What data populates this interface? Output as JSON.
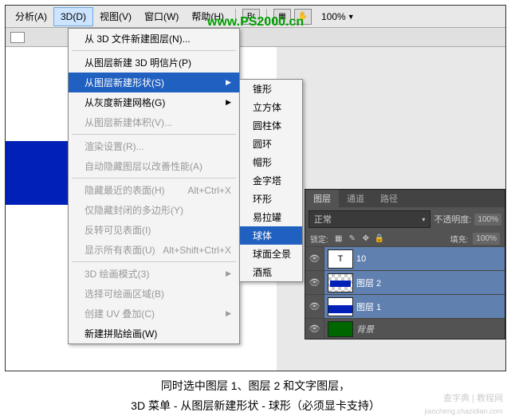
{
  "watermark": "www.PS2000.cn",
  "menubar": {
    "items": [
      "分析(A)",
      "3D(D)",
      "视图(V)",
      "窗口(W)",
      "帮助(H)"
    ],
    "zoom": "100%"
  },
  "dropdown": {
    "items": [
      {
        "label": "从 3D 文件新建图层(N)...",
        "disabled": false
      },
      {
        "sep": true
      },
      {
        "label": "从图层新建 3D 明信片(P)",
        "disabled": false
      },
      {
        "label": "从图层新建形状(S)",
        "hl": true,
        "arrow": true
      },
      {
        "label": "从灰度新建网格(G)",
        "arrow": true
      },
      {
        "label": "从图层新建体积(V)...",
        "disabled": true
      },
      {
        "sep": true
      },
      {
        "label": "渲染设置(R)...",
        "disabled": true
      },
      {
        "label": "自动隐藏图层以改善性能(A)",
        "disabled": true
      },
      {
        "sep": true
      },
      {
        "label": "隐藏最近的表面(H)",
        "shortcut": "Alt+Ctrl+X",
        "disabled": true
      },
      {
        "label": "仅隐藏封闭的多边形(Y)",
        "disabled": true
      },
      {
        "label": "反转可见表面(I)",
        "disabled": true
      },
      {
        "label": "显示所有表面(U)",
        "shortcut": "Alt+Shift+Ctrl+X",
        "disabled": true
      },
      {
        "sep": true
      },
      {
        "label": "3D 绘画模式(3)",
        "disabled": true,
        "arrow": true
      },
      {
        "label": "选择可绘画区域(B)",
        "disabled": true
      },
      {
        "label": "创建 UV 叠加(C)",
        "disabled": true,
        "arrow": true
      },
      {
        "label": "新建拼贴绘画(W)",
        "disabled": false
      }
    ]
  },
  "submenu": {
    "items": [
      "锥形",
      "立方体",
      "圆柱体",
      "圆环",
      "帽形",
      "金字塔",
      "环形",
      "易拉罐",
      "球体",
      "球面全景",
      "酒瓶"
    ],
    "hl_index": 8
  },
  "layerspanel": {
    "tabs": [
      "图层",
      "通道",
      "路径"
    ],
    "blendmode": "正常",
    "opacity_label": "不透明度:",
    "opacity": "100%",
    "lock_label": "锁定:",
    "fill_label": "填充:",
    "fill": "100%",
    "layers": [
      {
        "thumb": "T",
        "name": "10"
      },
      {
        "thumb": "checker",
        "name": "图层 2"
      },
      {
        "thumb": "blue",
        "name": "图层 1"
      },
      {
        "thumb": "bg",
        "name": "背景"
      }
    ]
  },
  "caption": {
    "line1": "同时选中图层 1、图层 2 和文字图层，",
    "line2": "3D 菜单 - 从图层新建形状 - 球形（必须显卡支持）"
  },
  "corner_wm": "查字典 | 教程网",
  "corner_wm2": "jiaocheng.chazidian.com"
}
